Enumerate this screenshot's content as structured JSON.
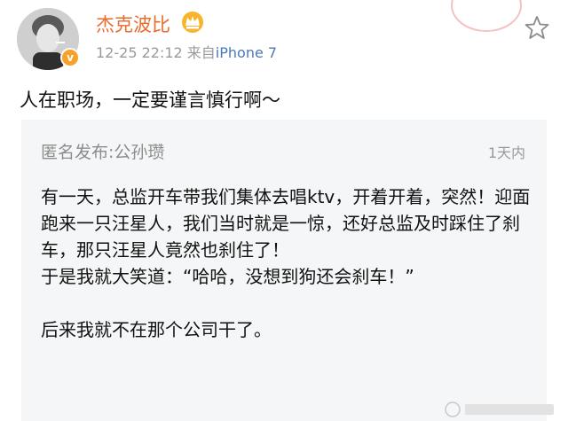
{
  "header": {
    "username": "杰克波比",
    "timestamp": "12-25 22:12",
    "source_prefix": "来自",
    "source_device": "iPhone 7",
    "verified_glyph": "v",
    "crown_icon": "crown-icon",
    "star_icon": "star-icon"
  },
  "post": {
    "text": "人在职场，一定要谨言慎行啊～"
  },
  "card": {
    "title": "匿名发布:公孙瓒",
    "time": "1天内",
    "paragraphs": [
      "有一天，总监开车带我们集体去唱ktv，开着开着，突然！迎面跑来一只汪星人，我们当时就是一惊，还好总监及时踩住了刹车，那只汪星人竟然也刹住了！",
      "于是我就大笑道：“哈哈，没想到狗还会刹车！”",
      "后来我就不在那个公司干了。"
    ]
  },
  "colors": {
    "username": "#ea6b2c",
    "source_link": "#4c79b6",
    "meta_gray": "#9a9a9a",
    "card_bg": "#f5f6f7",
    "badge": "#f7a12a"
  }
}
